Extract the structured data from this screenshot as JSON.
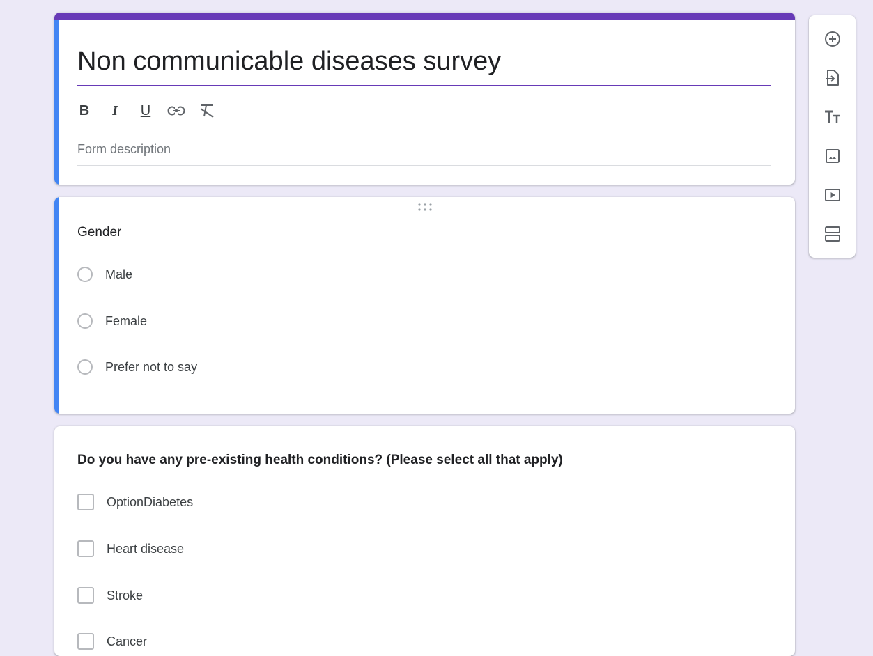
{
  "form": {
    "title": "Non communicable diseases survey",
    "description_placeholder": "Form description",
    "format_buttons": {
      "bold": "B",
      "italic": "I",
      "underline": "U"
    }
  },
  "questions": [
    {
      "title": "Gender",
      "type": "radio",
      "options": [
        "Male",
        "Female",
        "Prefer not to say"
      ]
    },
    {
      "title": "Do you have any pre-existing health conditions? (Please select all that apply)",
      "type": "checkbox",
      "options": [
        "OptionDiabetes",
        "Heart disease",
        "Stroke",
        "Cancer"
      ]
    }
  ],
  "sidebar": {
    "buttons": [
      "add-question-icon",
      "import-questions-icon",
      "add-title-icon",
      "add-image-icon",
      "add-video-icon",
      "add-section-icon"
    ]
  },
  "colors": {
    "header_accent": "#673ab7",
    "active_bar": "#4285f4",
    "page_background": "#ece9f7"
  }
}
